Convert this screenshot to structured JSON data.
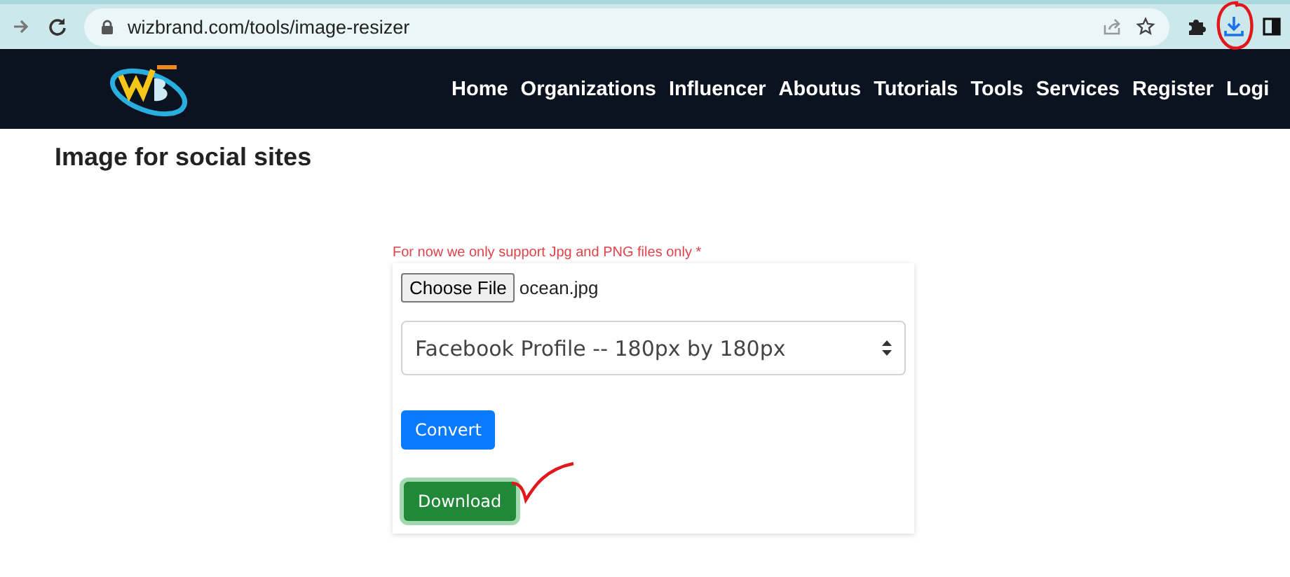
{
  "browser": {
    "url": "wizbrand.com/tools/image-resizer"
  },
  "nav": {
    "items": [
      "Home",
      "Organizations",
      "Influencer",
      "Aboutus",
      "Tutorials",
      "Tools",
      "Services",
      "Register",
      "Logi"
    ]
  },
  "page": {
    "heading": "Image for social sites"
  },
  "form": {
    "note": "For now we only support Jpg and PNG files only *",
    "file_button": "Choose File",
    "file_name": "ocean.jpg",
    "size_select": {
      "value": "Facebook Profile -- 180px by 180px"
    },
    "buttons": [
      {
        "label": "Convert",
        "kind": "primary"
      },
      {
        "label": "Download",
        "kind": "success"
      }
    ]
  }
}
